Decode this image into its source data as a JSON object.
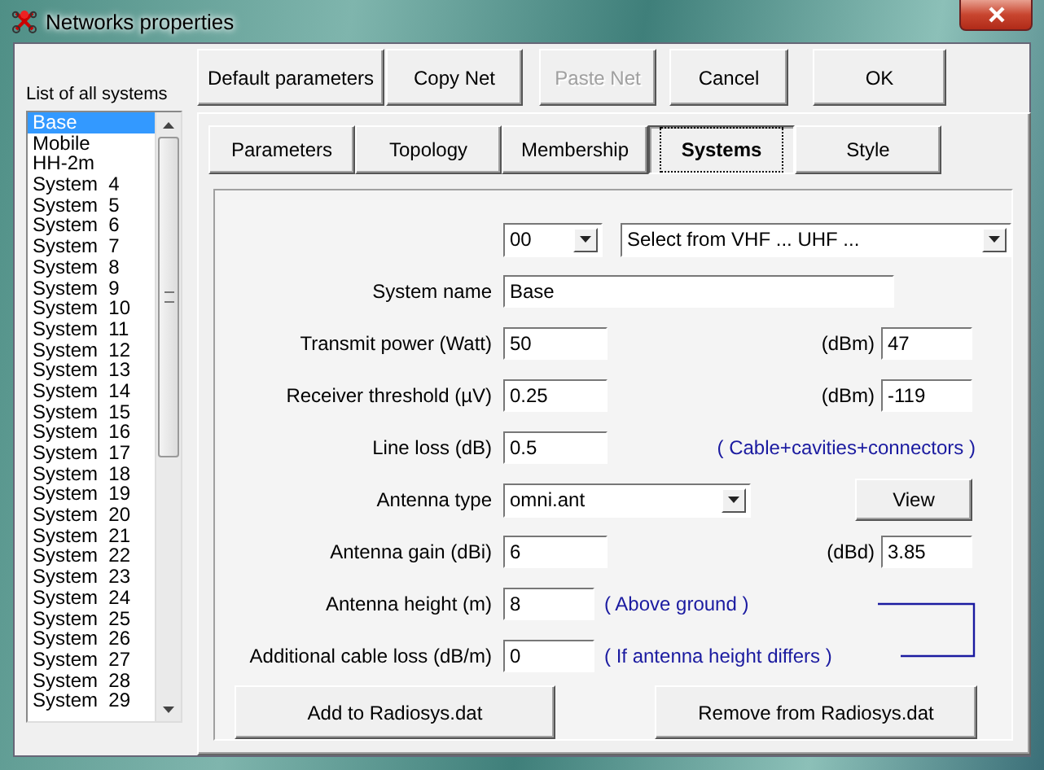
{
  "window": {
    "title": "Networks properties"
  },
  "list": {
    "label": "List of all systems",
    "items": [
      {
        "label": "Base",
        "selected": true
      },
      {
        "label": "Mobile",
        "selected": false
      },
      {
        "label": "HH-2m",
        "selected": false
      },
      {
        "label": "System  4",
        "selected": false
      },
      {
        "label": "System  5",
        "selected": false
      },
      {
        "label": "System  6",
        "selected": false
      },
      {
        "label": "System  7",
        "selected": false
      },
      {
        "label": "System  8",
        "selected": false
      },
      {
        "label": "System  9",
        "selected": false
      },
      {
        "label": "System  10",
        "selected": false
      },
      {
        "label": "System  11",
        "selected": false
      },
      {
        "label": "System  12",
        "selected": false
      },
      {
        "label": "System  13",
        "selected": false
      },
      {
        "label": "System  14",
        "selected": false
      },
      {
        "label": "System  15",
        "selected": false
      },
      {
        "label": "System  16",
        "selected": false
      },
      {
        "label": "System  17",
        "selected": false
      },
      {
        "label": "System  18",
        "selected": false
      },
      {
        "label": "System  19",
        "selected": false
      },
      {
        "label": "System  20",
        "selected": false
      },
      {
        "label": "System  21",
        "selected": false
      },
      {
        "label": "System  22",
        "selected": false
      },
      {
        "label": "System  23",
        "selected": false
      },
      {
        "label": "System  24",
        "selected": false
      },
      {
        "label": "System  25",
        "selected": false
      },
      {
        "label": "System  26",
        "selected": false
      },
      {
        "label": "System  27",
        "selected": false
      },
      {
        "label": "System  28",
        "selected": false
      },
      {
        "label": "System  29",
        "selected": false
      }
    ]
  },
  "buttons": [
    {
      "label": "Default parameters",
      "disabled": false
    },
    {
      "label": "Copy Net",
      "disabled": false
    },
    {
      "label": "Paste Net",
      "disabled": true
    },
    {
      "label": "Cancel",
      "disabled": false
    },
    {
      "label": "OK",
      "disabled": false
    }
  ],
  "tabs": [
    {
      "label": "Parameters",
      "selected": false
    },
    {
      "label": "Topology",
      "selected": false
    },
    {
      "label": "Membership",
      "selected": false
    },
    {
      "label": "Systems",
      "selected": true
    },
    {
      "label": "Style",
      "selected": false
    }
  ],
  "form": {
    "rows": [
      {
        "kind": "selects",
        "channel": "00",
        "band": "Select from VHF ... UHF ..."
      },
      {
        "kind": "wide",
        "label": "System name",
        "value": "Base"
      },
      {
        "kind": "pair",
        "label": "Transmit power (Watt)",
        "value": "50",
        "unit_label": "(dBm)",
        "unit_value": "47"
      },
      {
        "kind": "pair",
        "label": "Receiver threshold (µV)",
        "value": "0.25",
        "unit_label": "(dBm)",
        "unit_value": "-119"
      },
      {
        "kind": "note",
        "label": "Line loss (dB)",
        "value": "0.5",
        "note": "( Cable+cavities+connectors )"
      },
      {
        "kind": "select",
        "label": "Antenna type",
        "value": "omni.ant",
        "button": "View"
      },
      {
        "kind": "pair",
        "label": "Antenna gain (dBi)",
        "value": "6",
        "unit_label": "(dBd)",
        "unit_value": "3.85"
      },
      {
        "kind": "bracket",
        "label": "Antenna height (m)",
        "value": "8",
        "note": "( Above ground )"
      },
      {
        "kind": "bracket",
        "label": "Additional cable loss (dB/m)",
        "value": "0",
        "note": "( If antenna height differs )"
      }
    ],
    "actions": [
      "Add to Radiosys.dat",
      "Remove from Radiosys.dat"
    ]
  }
}
